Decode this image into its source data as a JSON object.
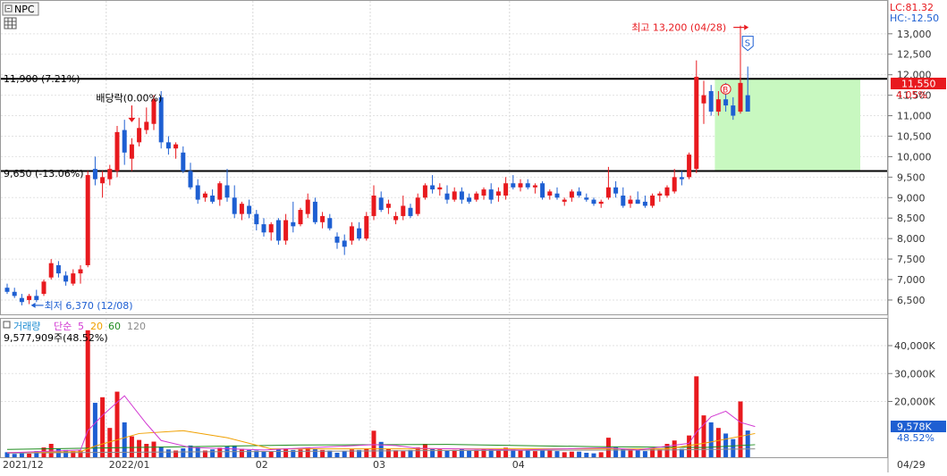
{
  "chart_data": {
    "type": "candlestick",
    "ticker": "NPC",
    "scales": {
      "lc": "LC:81.32",
      "hc": "HC:-12.50"
    },
    "price": {
      "ylim": [
        6150,
        13650
      ],
      "ticks": [
        "13,000",
        "12,500",
        "12,000",
        "11,500",
        "11,000",
        "10,500",
        "10,000",
        "9,500",
        "9,000",
        "8,500",
        "8,000",
        "7,500",
        "7,000",
        "6,500"
      ],
      "tick_values": [
        13000,
        12500,
        12000,
        11500,
        11000,
        10500,
        10000,
        9500,
        9000,
        8500,
        8000,
        7500,
        7000,
        6500
      ],
      "current": {
        "value": 11550,
        "label": "11,550",
        "change": "4.05%"
      },
      "hlines": [
        {
          "value": 11900,
          "label": "11,900 (7.21%)"
        },
        {
          "value": 9650,
          "label": "9,650 (-13.06%)"
        }
      ],
      "annotations": {
        "high": {
          "label": "최고 13,200 (04/28)",
          "value": 13200
        },
        "low": {
          "label": "최저 6,370 (12/08)",
          "value": 6370
        },
        "ex_dividend": "배당락(0.00%)",
        "signal_s": "S",
        "signal_b": "B"
      },
      "highlight_zone": {
        "from": 9650,
        "to": 11900
      }
    },
    "volume": {
      "legend": {
        "title": "거래량",
        "ma_label": "단순",
        "periods": [
          "5",
          "20",
          "60",
          "120"
        ]
      },
      "summary": "9,577,909주(48.52%)",
      "ylim": [
        0,
        48000
      ],
      "ticks": [
        "40,000K",
        "30,000K",
        "20,000K"
      ],
      "tick_values": [
        40000,
        30000,
        20000
      ],
      "current": {
        "label": "9,578K",
        "pct": "48.52%"
      }
    },
    "x_labels": [
      {
        "label": "2021/12",
        "index": -1
      },
      {
        "label": "2022/01",
        "index": 14
      },
      {
        "label": "02",
        "index": 34
      },
      {
        "label": "03",
        "index": 50
      },
      {
        "label": "04",
        "index": 69
      },
      {
        "label": "04/29",
        "index": 102
      }
    ],
    "candles": [
      {
        "o": 6800,
        "h": 6900,
        "l": 6650,
        "c": 6700,
        "v": 1800
      },
      {
        "o": 6700,
        "h": 6800,
        "l": 6550,
        "c": 6600,
        "v": 1200
      },
      {
        "o": 6550,
        "h": 6650,
        "l": 6370,
        "c": 6450,
        "v": 1500
      },
      {
        "o": 6500,
        "h": 6650,
        "l": 6400,
        "c": 6600,
        "v": 1300
      },
      {
        "o": 6600,
        "h": 6750,
        "l": 6450,
        "c": 6500,
        "v": 2200
      },
      {
        "o": 6650,
        "h": 7000,
        "l": 6600,
        "c": 6950,
        "v": 3500
      },
      {
        "o": 7050,
        "h": 7500,
        "l": 7000,
        "c": 7400,
        "v": 4800
      },
      {
        "o": 7350,
        "h": 7450,
        "l": 7050,
        "c": 7150,
        "v": 3000
      },
      {
        "o": 7100,
        "h": 7200,
        "l": 6850,
        "c": 6950,
        "v": 2600
      },
      {
        "o": 6900,
        "h": 7250,
        "l": 6850,
        "c": 7150,
        "v": 2200
      },
      {
        "o": 7150,
        "h": 7350,
        "l": 6900,
        "c": 7250,
        "v": 2400
      },
      {
        "o": 7350,
        "h": 9650,
        "l": 7300,
        "c": 9550,
        "v": 45500
      },
      {
        "o": 9700,
        "h": 10000,
        "l": 9300,
        "c": 9450,
        "v": 19500
      },
      {
        "o": 9350,
        "h": 9650,
        "l": 9000,
        "c": 9500,
        "v": 21500
      },
      {
        "o": 9450,
        "h": 9800,
        "l": 9300,
        "c": 9700,
        "v": 10500
      },
      {
        "o": 9650,
        "h": 10750,
        "l": 9500,
        "c": 10600,
        "v": 23500
      },
      {
        "o": 10650,
        "h": 10900,
        "l": 9800,
        "c": 10100,
        "v": 12500
      },
      {
        "o": 9950,
        "h": 10450,
        "l": 9650,
        "c": 10300,
        "v": 7500
      },
      {
        "o": 10350,
        "h": 10950,
        "l": 10250,
        "c": 10700,
        "v": 6200
      },
      {
        "o": 10650,
        "h": 11200,
        "l": 10550,
        "c": 10850,
        "v": 4800
      },
      {
        "o": 10800,
        "h": 11500,
        "l": 10650,
        "c": 11400,
        "v": 5600
      },
      {
        "o": 11450,
        "h": 11600,
        "l": 10200,
        "c": 10350,
        "v": 3800
      },
      {
        "o": 10350,
        "h": 10500,
        "l": 10050,
        "c": 10200,
        "v": 2800
      },
      {
        "o": 10200,
        "h": 10350,
        "l": 9950,
        "c": 10300,
        "v": 2400
      },
      {
        "o": 10100,
        "h": 10250,
        "l": 9600,
        "c": 9650,
        "v": 3200
      },
      {
        "o": 9650,
        "h": 9850,
        "l": 9200,
        "c": 9250,
        "v": 4200
      },
      {
        "o": 9300,
        "h": 9450,
        "l": 8850,
        "c": 8950,
        "v": 3600
      },
      {
        "o": 9000,
        "h": 9150,
        "l": 8900,
        "c": 9100,
        "v": 2400
      },
      {
        "o": 9050,
        "h": 9200,
        "l": 8850,
        "c": 8900,
        "v": 2800
      },
      {
        "o": 8950,
        "h": 9400,
        "l": 8800,
        "c": 9350,
        "v": 3400
      },
      {
        "o": 9300,
        "h": 9700,
        "l": 8900,
        "c": 9000,
        "v": 3800
      },
      {
        "o": 9000,
        "h": 9300,
        "l": 8500,
        "c": 8600,
        "v": 4200
      },
      {
        "o": 8600,
        "h": 8900,
        "l": 8450,
        "c": 8850,
        "v": 3000
      },
      {
        "o": 8800,
        "h": 8950,
        "l": 8500,
        "c": 8600,
        "v": 2600
      },
      {
        "o": 8600,
        "h": 8700,
        "l": 8200,
        "c": 8350,
        "v": 2400
      },
      {
        "o": 8350,
        "h": 8500,
        "l": 8050,
        "c": 8150,
        "v": 2000
      },
      {
        "o": 8150,
        "h": 8400,
        "l": 7950,
        "c": 8350,
        "v": 2200
      },
      {
        "o": 8450,
        "h": 8500,
        "l": 7850,
        "c": 7950,
        "v": 3000
      },
      {
        "o": 7950,
        "h": 8600,
        "l": 7850,
        "c": 8450,
        "v": 3200
      },
      {
        "o": 8400,
        "h": 8900,
        "l": 8150,
        "c": 8300,
        "v": 2600
      },
      {
        "o": 8350,
        "h": 8750,
        "l": 8300,
        "c": 8700,
        "v": 2800
      },
      {
        "o": 8600,
        "h": 9100,
        "l": 8500,
        "c": 8950,
        "v": 3500
      },
      {
        "o": 8900,
        "h": 9000,
        "l": 8350,
        "c": 8400,
        "v": 3000
      },
      {
        "o": 8400,
        "h": 8650,
        "l": 8250,
        "c": 8550,
        "v": 2600
      },
      {
        "o": 8500,
        "h": 8600,
        "l": 8200,
        "c": 8250,
        "v": 2400
      },
      {
        "o": 8050,
        "h": 8150,
        "l": 7750,
        "c": 7900,
        "v": 1600
      },
      {
        "o": 7950,
        "h": 8100,
        "l": 7600,
        "c": 7800,
        "v": 2200
      },
      {
        "o": 7950,
        "h": 8400,
        "l": 7850,
        "c": 8300,
        "v": 2800
      },
      {
        "o": 8250,
        "h": 8400,
        "l": 7950,
        "c": 8000,
        "v": 2600
      },
      {
        "o": 8000,
        "h": 8650,
        "l": 7950,
        "c": 8550,
        "v": 3200
      },
      {
        "o": 8550,
        "h": 9300,
        "l": 8450,
        "c": 9050,
        "v": 9500
      },
      {
        "o": 9000,
        "h": 9150,
        "l": 8650,
        "c": 8700,
        "v": 5500
      },
      {
        "o": 8750,
        "h": 8950,
        "l": 8600,
        "c": 8850,
        "v": 3000
      },
      {
        "o": 8450,
        "h": 8650,
        "l": 8350,
        "c": 8550,
        "v": 2500
      },
      {
        "o": 8550,
        "h": 9050,
        "l": 8450,
        "c": 8800,
        "v": 2200
      },
      {
        "o": 8750,
        "h": 8850,
        "l": 8500,
        "c": 8550,
        "v": 2600
      },
      {
        "o": 8600,
        "h": 9100,
        "l": 8550,
        "c": 9000,
        "v": 3500
      },
      {
        "o": 9000,
        "h": 9350,
        "l": 8950,
        "c": 9300,
        "v": 4800
      },
      {
        "o": 9300,
        "h": 9550,
        "l": 9100,
        "c": 9200,
        "v": 3200
      },
      {
        "o": 9200,
        "h": 9350,
        "l": 9050,
        "c": 9250,
        "v": 2800
      },
      {
        "o": 9100,
        "h": 9300,
        "l": 8850,
        "c": 8950,
        "v": 2400
      },
      {
        "o": 8950,
        "h": 9250,
        "l": 8900,
        "c": 9150,
        "v": 2600
      },
      {
        "o": 9150,
        "h": 9250,
        "l": 8850,
        "c": 8950,
        "v": 3000
      },
      {
        "o": 9000,
        "h": 9100,
        "l": 8850,
        "c": 8900,
        "v": 2400
      },
      {
        "o": 8950,
        "h": 9150,
        "l": 8900,
        "c": 9100,
        "v": 2600
      },
      {
        "o": 9050,
        "h": 9250,
        "l": 8950,
        "c": 9200,
        "v": 2800
      },
      {
        "o": 9200,
        "h": 9350,
        "l": 8850,
        "c": 8950,
        "v": 3000
      },
      {
        "o": 9050,
        "h": 9250,
        "l": 8900,
        "c": 9150,
        "v": 2600
      },
      {
        "o": 9050,
        "h": 9500,
        "l": 8950,
        "c": 9350,
        "v": 3400
      },
      {
        "o": 9350,
        "h": 9550,
        "l": 9200,
        "c": 9250,
        "v": 2800
      },
      {
        "o": 9250,
        "h": 9450,
        "l": 9150,
        "c": 9350,
        "v": 2600
      },
      {
        "o": 9350,
        "h": 9450,
        "l": 9200,
        "c": 9250,
        "v": 2400
      },
      {
        "o": 9250,
        "h": 9350,
        "l": 9100,
        "c": 9300,
        "v": 2200
      },
      {
        "o": 9350,
        "h": 9400,
        "l": 8950,
        "c": 9000,
        "v": 2600
      },
      {
        "o": 9050,
        "h": 9200,
        "l": 8950,
        "c": 9150,
        "v": 2400
      },
      {
        "o": 9100,
        "h": 9250,
        "l": 8950,
        "c": 9000,
        "v": 2200
      },
      {
        "o": 8900,
        "h": 9000,
        "l": 8800,
        "c": 8950,
        "v": 1800
      },
      {
        "o": 9000,
        "h": 9200,
        "l": 8900,
        "c": 9150,
        "v": 2000
      },
      {
        "o": 9150,
        "h": 9250,
        "l": 9000,
        "c": 9050,
        "v": 2000
      },
      {
        "o": 9000,
        "h": 9100,
        "l": 8900,
        "c": 8950,
        "v": 1600
      },
      {
        "o": 8950,
        "h": 9000,
        "l": 8800,
        "c": 8850,
        "v": 1400
      },
      {
        "o": 8850,
        "h": 8950,
        "l": 8750,
        "c": 8900,
        "v": 1800
      },
      {
        "o": 9000,
        "h": 9750,
        "l": 8950,
        "c": 9250,
        "v": 7000
      },
      {
        "o": 9250,
        "h": 9400,
        "l": 9000,
        "c": 9100,
        "v": 3600
      },
      {
        "o": 9050,
        "h": 9250,
        "l": 8750,
        "c": 8800,
        "v": 3000
      },
      {
        "o": 8850,
        "h": 9050,
        "l": 8750,
        "c": 8950,
        "v": 2400
      },
      {
        "o": 8950,
        "h": 9150,
        "l": 8850,
        "c": 8850,
        "v": 2600
      },
      {
        "o": 8900,
        "h": 9050,
        "l": 8750,
        "c": 8800,
        "v": 2200
      },
      {
        "o": 8800,
        "h": 9100,
        "l": 8750,
        "c": 9050,
        "v": 3200
      },
      {
        "o": 9050,
        "h": 9150,
        "l": 8900,
        "c": 9100,
        "v": 2800
      },
      {
        "o": 9050,
        "h": 9300,
        "l": 9000,
        "c": 9250,
        "v": 4800
      },
      {
        "o": 9150,
        "h": 9700,
        "l": 9100,
        "c": 9500,
        "v": 6000
      },
      {
        "o": 9500,
        "h": 9650,
        "l": 9300,
        "c": 9450,
        "v": 3000
      },
      {
        "o": 9500,
        "h": 10100,
        "l": 9450,
        "c": 10050,
        "v": 7800
      },
      {
        "o": 9700,
        "h": 12350,
        "l": 9600,
        "c": 11950,
        "v": 29000
      },
      {
        "o": 11300,
        "h": 11850,
        "l": 10800,
        "c": 11500,
        "v": 15000
      },
      {
        "o": 11600,
        "h": 11750,
        "l": 11000,
        "c": 11100,
        "v": 12500
      },
      {
        "o": 11100,
        "h": 11600,
        "l": 11000,
        "c": 11400,
        "v": 10500
      },
      {
        "o": 11400,
        "h": 11800,
        "l": 11100,
        "c": 11250,
        "v": 8500
      },
      {
        "o": 11250,
        "h": 11450,
        "l": 10900,
        "c": 11000,
        "v": 6500
      },
      {
        "o": 11100,
        "h": 13200,
        "l": 11050,
        "c": 11800,
        "v": 20000
      },
      {
        "o": 11500,
        "h": 12200,
        "l": 11100,
        "c": 11100,
        "v": 9578
      }
    ],
    "ma_volume": {
      "ma5": [
        {
          "i": 0,
          "v": 1600
        },
        {
          "i": 10,
          "v": 2600
        },
        {
          "i": 11,
          "v": 9500
        },
        {
          "i": 13,
          "v": 15000
        },
        {
          "i": 16,
          "v": 22000
        },
        {
          "i": 19,
          "v": 12000
        },
        {
          "i": 21,
          "v": 6000
        },
        {
          "i": 25,
          "v": 3500
        },
        {
          "i": 35,
          "v": 2600
        },
        {
          "i": 50,
          "v": 4500
        },
        {
          "i": 53,
          "v": 4200
        },
        {
          "i": 56,
          "v": 3200
        },
        {
          "i": 70,
          "v": 2600
        },
        {
          "i": 82,
          "v": 3400
        },
        {
          "i": 86,
          "v": 2600
        },
        {
          "i": 93,
          "v": 5000
        },
        {
          "i": 94,
          "v": 9000
        },
        {
          "i": 96,
          "v": 14500
        },
        {
          "i": 98,
          "v": 16500
        },
        {
          "i": 100,
          "v": 12500
        },
        {
          "i": 102,
          "v": 11000
        }
      ],
      "ma20": [
        {
          "i": 0,
          "v": 1700
        },
        {
          "i": 10,
          "v": 2000
        },
        {
          "i": 12,
          "v": 4000
        },
        {
          "i": 18,
          "v": 8500
        },
        {
          "i": 24,
          "v": 9500
        },
        {
          "i": 30,
          "v": 7000
        },
        {
          "i": 36,
          "v": 3000
        },
        {
          "i": 50,
          "v": 3000
        },
        {
          "i": 70,
          "v": 3000
        },
        {
          "i": 90,
          "v": 3000
        },
        {
          "i": 95,
          "v": 5000
        },
        {
          "i": 102,
          "v": 8500
        }
      ],
      "ma60": [
        {
          "i": 0,
          "v": 2800
        },
        {
          "i": 20,
          "v": 3600
        },
        {
          "i": 40,
          "v": 4400
        },
        {
          "i": 60,
          "v": 4600
        },
        {
          "i": 80,
          "v": 3800
        },
        {
          "i": 95,
          "v": 3500
        },
        {
          "i": 102,
          "v": 4500
        }
      ],
      "ma120": [
        {
          "i": 0,
          "v": 1500
        },
        {
          "i": 30,
          "v": 2000
        },
        {
          "i": 60,
          "v": 2400
        },
        {
          "i": 90,
          "v": 2600
        },
        {
          "i": 102,
          "v": 3000
        }
      ]
    }
  },
  "colors": {
    "up": "#e8191e",
    "down": "#1e5fd2",
    "ma5": "#d23ad2",
    "ma20": "#f0a000",
    "ma60": "#1e8c1e",
    "ma120": "#8c8c8c",
    "zone": "#c8f8c0",
    "hline": "#000000",
    "current_badge": "#e8191e",
    "volume_badge": "#1e5fd2"
  }
}
